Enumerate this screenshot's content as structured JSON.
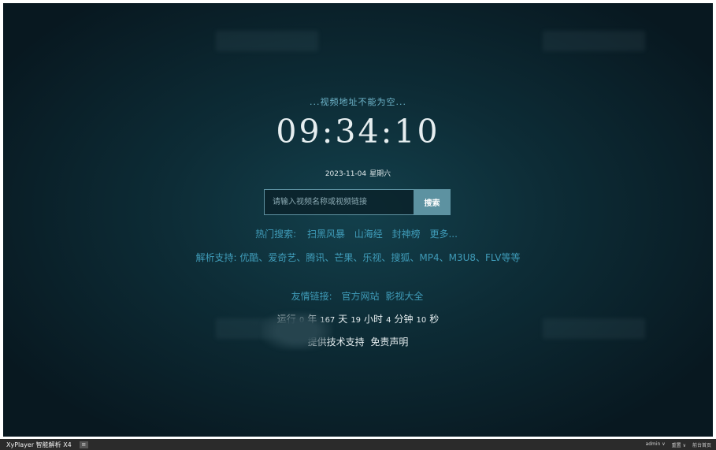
{
  "status_text": "...视频地址不能为空...",
  "clock": "09:34:10",
  "date": {
    "day": "2023-11-04",
    "weekday": "星期六"
  },
  "search": {
    "placeholder": "请输入视频名称或视频链接",
    "button_label": "搜索"
  },
  "hot_search": {
    "label": "热门搜索:",
    "items": [
      "扫黑风暴",
      "山海经",
      "封神榜",
      "更多..."
    ]
  },
  "support_text": "解析支持: 优酷、爱奇艺、腾讯、芒果、乐视、搜狐、MP4、M3U8、FLV等等",
  "friend_links": {
    "label": "友情链接:",
    "items": [
      "官方网站",
      "影视大全"
    ]
  },
  "runtime": {
    "prefix": "运行",
    "years": "0",
    "year_unit": "年",
    "days": "167",
    "day_unit": "天",
    "hours": "19",
    "hour_unit": "小时",
    "minutes": "4",
    "minute_unit": "分钟",
    "seconds": "10",
    "second_unit": "秒"
  },
  "credit": {
    "text": "提供技术支持",
    "disclaimer": "免责声明"
  },
  "taskbar": {
    "app_title": "XyPlayer 智能解析 X4",
    "menu_icon": "menu-icon",
    "right_items": [
      "admin ∨",
      "重置 ∨",
      "前台首页"
    ]
  },
  "colors": {
    "accent": "#3f9bb8",
    "button": "#5d92a1",
    "background": "#0d2c36"
  }
}
